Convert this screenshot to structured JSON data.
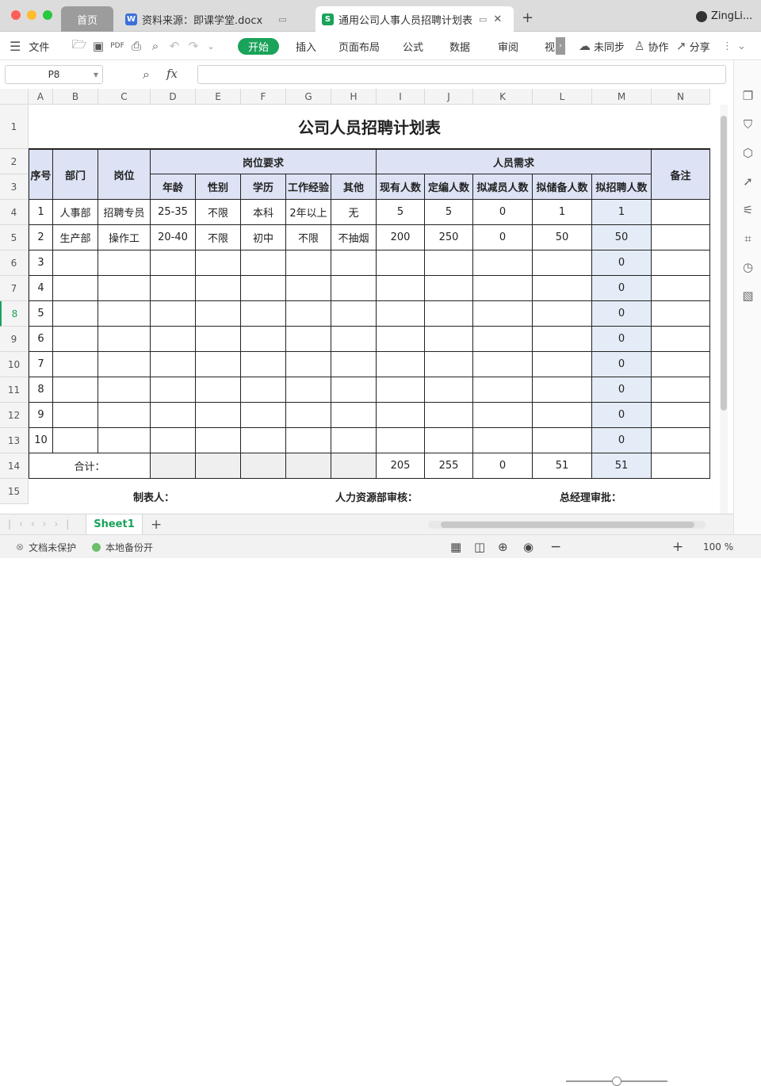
{
  "tabs": {
    "home": "首页",
    "doc": "资料来源：即课学堂.docx",
    "active": "通用公司人事人员招聘计划表",
    "new_tab": "+"
  },
  "user": {
    "name": "ZingLi..."
  },
  "toolbar": {
    "file_label": "文件",
    "menus": [
      "开始",
      "插入",
      "页面布局",
      "公式",
      "数据",
      "审阅",
      "视"
    ],
    "sync_label": "未同步",
    "collab_label": "协作",
    "share_label": "分享"
  },
  "formula": {
    "cell_ref": "P8",
    "fx_label": "fx",
    "value": ""
  },
  "columns": [
    "A",
    "B",
    "C",
    "D",
    "E",
    "F",
    "G",
    "H",
    "I",
    "J",
    "K",
    "L",
    "M",
    "N"
  ],
  "rows": [
    "1",
    "2",
    "3",
    "4",
    "5",
    "6",
    "7",
    "8",
    "9",
    "10",
    "11",
    "12",
    "13",
    "14",
    "15"
  ],
  "sheet": {
    "title": "公司人员招聘计划表",
    "h_seq": "序号",
    "h_dept": "部门",
    "h_pos": "岗位",
    "h_group1": "岗位要求",
    "h_group2": "人员需求",
    "h_note": "备注",
    "sub_headers": [
      "年龄",
      "性别",
      "学历",
      "工作经验",
      "其他",
      "现有人数",
      "定编人数",
      "拟减员人数",
      "拟储备人数",
      "拟招聘人数"
    ],
    "data_rows": [
      [
        "1",
        "人事部",
        "招聘专员",
        "25-35",
        "不限",
        "本科",
        "2年以上",
        "无",
        "5",
        "5",
        "0",
        "1",
        "1",
        ""
      ],
      [
        "2",
        "生产部",
        "操作工",
        "20-40",
        "不限",
        "初中",
        "不限",
        "不抽烟",
        "200",
        "250",
        "0",
        "50",
        "50",
        ""
      ],
      [
        "3",
        "",
        "",
        "",
        "",
        "",
        "",
        "",
        "",
        "",
        "",
        "",
        "0",
        ""
      ],
      [
        "4",
        "",
        "",
        "",
        "",
        "",
        "",
        "",
        "",
        "",
        "",
        "",
        "0",
        ""
      ],
      [
        "5",
        "",
        "",
        "",
        "",
        "",
        "",
        "",
        "",
        "",
        "",
        "",
        "0",
        ""
      ],
      [
        "6",
        "",
        "",
        "",
        "",
        "",
        "",
        "",
        "",
        "",
        "",
        "",
        "0",
        ""
      ],
      [
        "7",
        "",
        "",
        "",
        "",
        "",
        "",
        "",
        "",
        "",
        "",
        "",
        "0",
        ""
      ],
      [
        "8",
        "",
        "",
        "",
        "",
        "",
        "",
        "",
        "",
        "",
        "",
        "",
        "0",
        ""
      ],
      [
        "9",
        "",
        "",
        "",
        "",
        "",
        "",
        "",
        "",
        "",
        "",
        "",
        "0",
        ""
      ],
      [
        "10",
        "",
        "",
        "",
        "",
        "",
        "",
        "",
        "",
        "",
        "",
        "",
        "0",
        ""
      ]
    ],
    "total_label": "合计：",
    "totals": [
      "205",
      "255",
      "0",
      "51",
      "51"
    ],
    "footer_maker": "制表人：",
    "footer_hr": "人力资源部审核：",
    "footer_gm": "总经理审批："
  },
  "sheet_tab": "Sheet1",
  "status": {
    "protect": "文档未保护",
    "backup": "本地备份开",
    "zoom": "100 %"
  },
  "colors": {
    "accent": "#1aa35a",
    "header_fill": "#dde3f5",
    "highlight_col": "#e4ecf7"
  }
}
